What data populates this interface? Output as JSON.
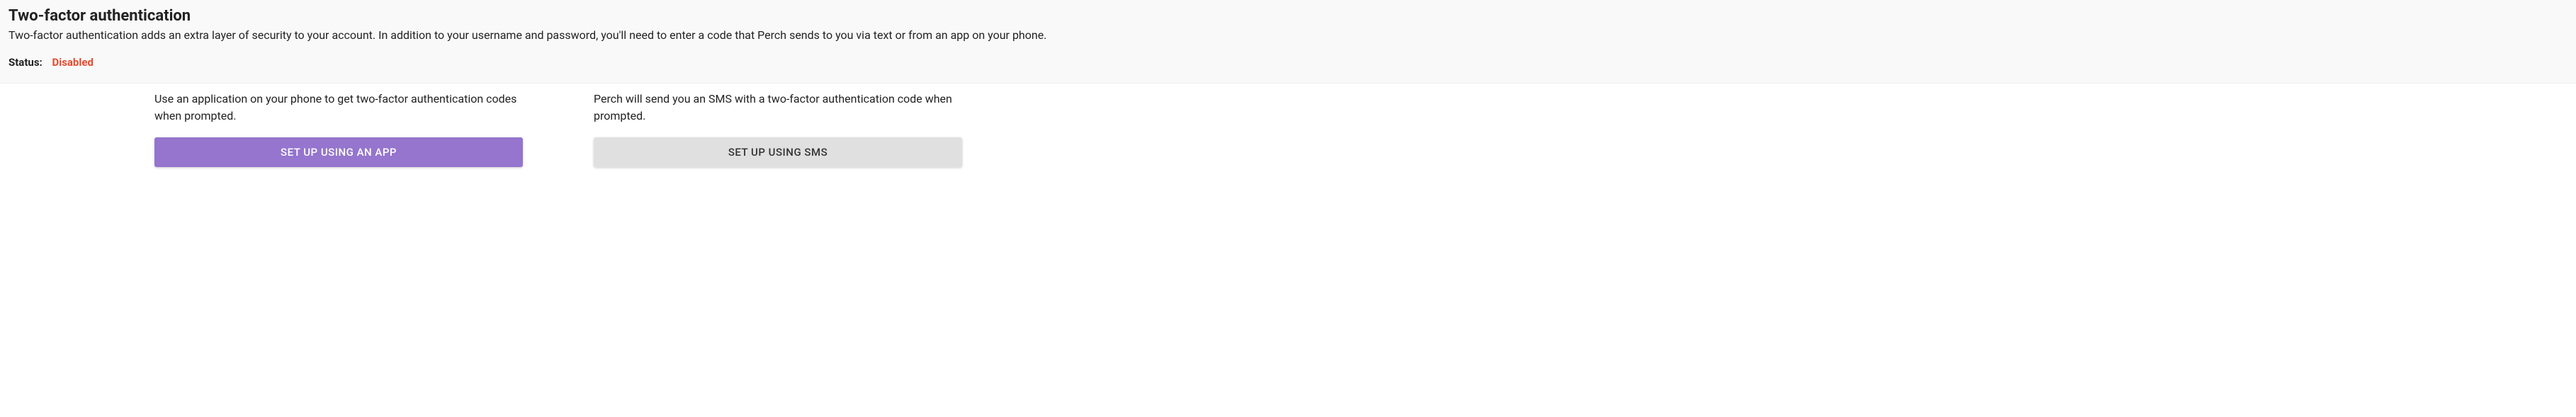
{
  "header": {
    "title": "Two-factor authentication",
    "description": "Two-factor authentication adds an extra layer of security to your account. In addition to your username and password, you'll need to enter a code that Perch sends to you via text or from an app on your phone.",
    "status_label": "Status:",
    "status_value": "Disabled",
    "status_color": "#e64a2f"
  },
  "options": {
    "app": {
      "description": "Use an application on your phone to get two-factor authentication codes when prompted.",
      "button_label": "Set up using an app"
    },
    "sms": {
      "description": "Perch will send you an SMS with a two-factor authentication code when prompted.",
      "button_label": "Set up using SMS"
    }
  }
}
